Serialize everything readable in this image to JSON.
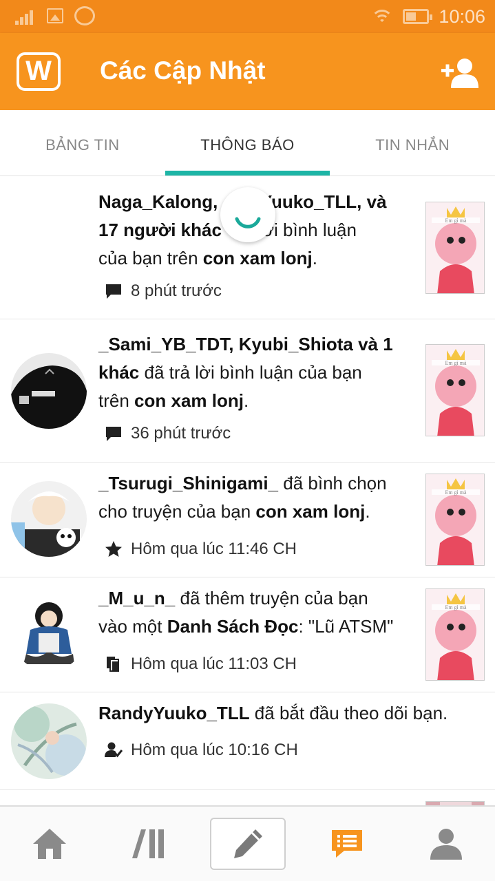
{
  "status_bar": {
    "time": "10:06"
  },
  "app_bar": {
    "logo_text": "W",
    "title": "Các Cập Nhật"
  },
  "tabs": [
    {
      "label": "BẢNG TIN"
    },
    {
      "label": "THÔNG BÁO"
    },
    {
      "label": "TIN NHẮN"
    }
  ],
  "notifications": [
    {
      "actor": "Naga_Kalong, RandyYuuko_TLL, và 17 người khác",
      "line1a": "Naga_Kalong, ",
      "line1b": "yYuuko_TLL, và",
      "line2a": "17 người khác",
      "line2b": "lời bình luận",
      "line3a": "của bạn trên ",
      "story": "con xam lonj",
      "suffix": ".",
      "time": "8 phút trước",
      "meta_icon": "comment-icon",
      "avatar": "none"
    },
    {
      "line1": "_Sami_YB_TDT, Kyubi_Shiota và 1",
      "line2a": "khác",
      "line2b": " đã trả lời bình luận của bạn",
      "line3a": "trên ",
      "story": "con xam lonj",
      "suffix": ".",
      "time": "36 phút trước",
      "meta_icon": "comment-icon"
    },
    {
      "actor": "_Tsurugi_Shinigami_",
      "line1b": " đã bình chọn",
      "line2a": "cho truyện của bạn ",
      "story": "con xam lonj",
      "suffix": ".",
      "time": "Hôm qua lúc 11:46 CH",
      "meta_icon": "star-icon"
    },
    {
      "actor": "_M_u_n_",
      "line1b": " đã thêm truyện của bạn",
      "line2a": "vào một ",
      "list_word": "Danh Sách Đọc",
      "line2c": ": \"Lũ ATSM\"",
      "time": "Hôm qua lúc 11:03 CH",
      "meta_icon": "reading-list-icon"
    },
    {
      "actor": "RandyYuuko_TLL",
      "line1b": " đã bắt đầu theo dõi bạn.",
      "time": "Hôm qua lúc 10:16 CH",
      "meta_icon": "follow-icon"
    }
  ],
  "thumb_caption": "Em gì mà",
  "colors": {
    "accent": "#f7941e",
    "tab_indicator": "#1db5a6",
    "messages_icon": "#f7941e"
  }
}
